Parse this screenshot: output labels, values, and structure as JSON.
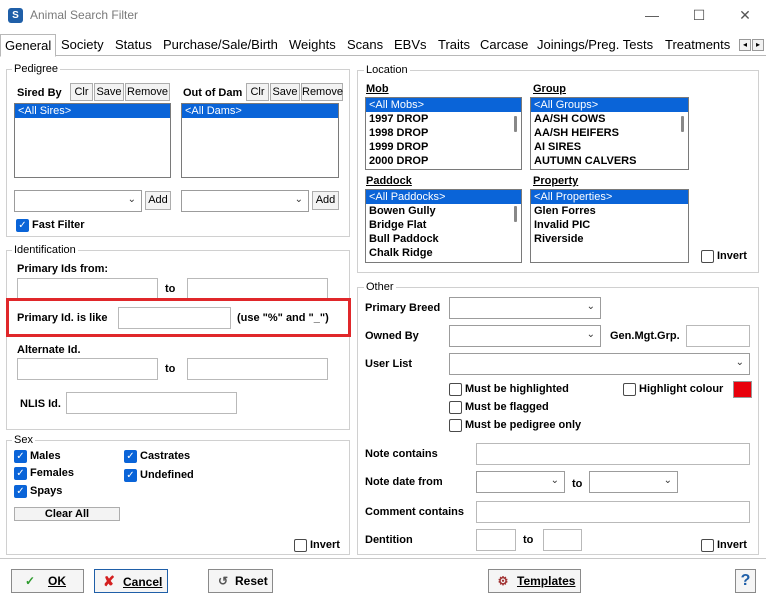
{
  "window": {
    "title": "Animal Search Filter",
    "minimize": "—",
    "maximize": "☐",
    "close": "✕",
    "app_icon": "S"
  },
  "tabs": [
    {
      "label": "General",
      "active": true
    },
    {
      "label": "Society"
    },
    {
      "label": "Status"
    },
    {
      "label": "Purchase/Sale/Birth"
    },
    {
      "label": "Weights"
    },
    {
      "label": "Scans"
    },
    {
      "label": "EBVs"
    },
    {
      "label": "Traits"
    },
    {
      "label": "Carcase"
    },
    {
      "label": "Joinings/Preg. Tests"
    },
    {
      "label": "Treatments"
    }
  ],
  "tab_scroll": {
    "left": "◂",
    "right": "▸"
  },
  "pedigree": {
    "title": "Pedigree",
    "sires": {
      "label": "Sired By",
      "clr": "Clr",
      "save": "Save",
      "remove": "Remove",
      "items": [
        "<All Sires>"
      ],
      "add": "Add"
    },
    "dams": {
      "label": "Out of Dam",
      "clr": "Clr",
      "save": "Save",
      "remove": "Remove",
      "items": [
        "<All Dams>"
      ],
      "add": "Add"
    },
    "fast_filter": {
      "label": "Fast Filter",
      "checked": true
    }
  },
  "identification": {
    "title": "Identification",
    "primary_ids_from": "Primary Ids from:",
    "to": "to",
    "primary_like": "Primary Id. is like",
    "primary_like_hint": "(use \"%\" and \"_\")",
    "alternate": "Alternate Id.",
    "nlis": "NLIS Id."
  },
  "sex": {
    "title": "Sex",
    "males": "Males",
    "females": "Females",
    "spays": "Spays",
    "castrates": "Castrates",
    "undefined": "Undefined",
    "clear_all": "Clear All",
    "invert": "Invert"
  },
  "location": {
    "title": "Location",
    "mob": {
      "label": "Mob",
      "items": [
        "<All Mobs>",
        "1997 DROP",
        "1998 DROP",
        "1999 DROP",
        "2000 DROP"
      ]
    },
    "group": {
      "label": "Group",
      "items": [
        "<All Groups>",
        "AA/SH COWS",
        "AA/SH HEIFERS",
        "AI SIRES",
        "AUTUMN CALVERS"
      ]
    },
    "paddock": {
      "label": "Paddock",
      "items": [
        "<All Paddocks>",
        "Bowen Gully",
        "Bridge Flat",
        "Bull Paddock",
        "Chalk Ridge"
      ]
    },
    "property": {
      "label": "Property",
      "items": [
        "<All Properties>",
        "Glen Forres",
        "Invalid PIC",
        "Riverside"
      ]
    },
    "invert": "Invert"
  },
  "other": {
    "title": "Other",
    "primary_breed": "Primary Breed",
    "owned_by": "Owned By",
    "gen_mgt": "Gen.Mgt.Grp.",
    "user_list": "User List",
    "must_highlighted": "Must be highlighted",
    "highlight_colour": "Highlight colour",
    "highlight_color_value": "#e8000b",
    "must_flagged": "Must be flagged",
    "must_pedigree": "Must be pedigree only",
    "note_contains": "Note contains",
    "note_date_from": "Note date from",
    "to": "to",
    "comment_contains": "Comment contains",
    "dentition": "Dentition",
    "invert": "Invert"
  },
  "buttons": {
    "ok": "OK",
    "cancel": "Cancel",
    "reset": "Reset",
    "templates": "Templates",
    "help": "?"
  },
  "icons": {
    "dropdown": "⌄",
    "check": "✓"
  }
}
